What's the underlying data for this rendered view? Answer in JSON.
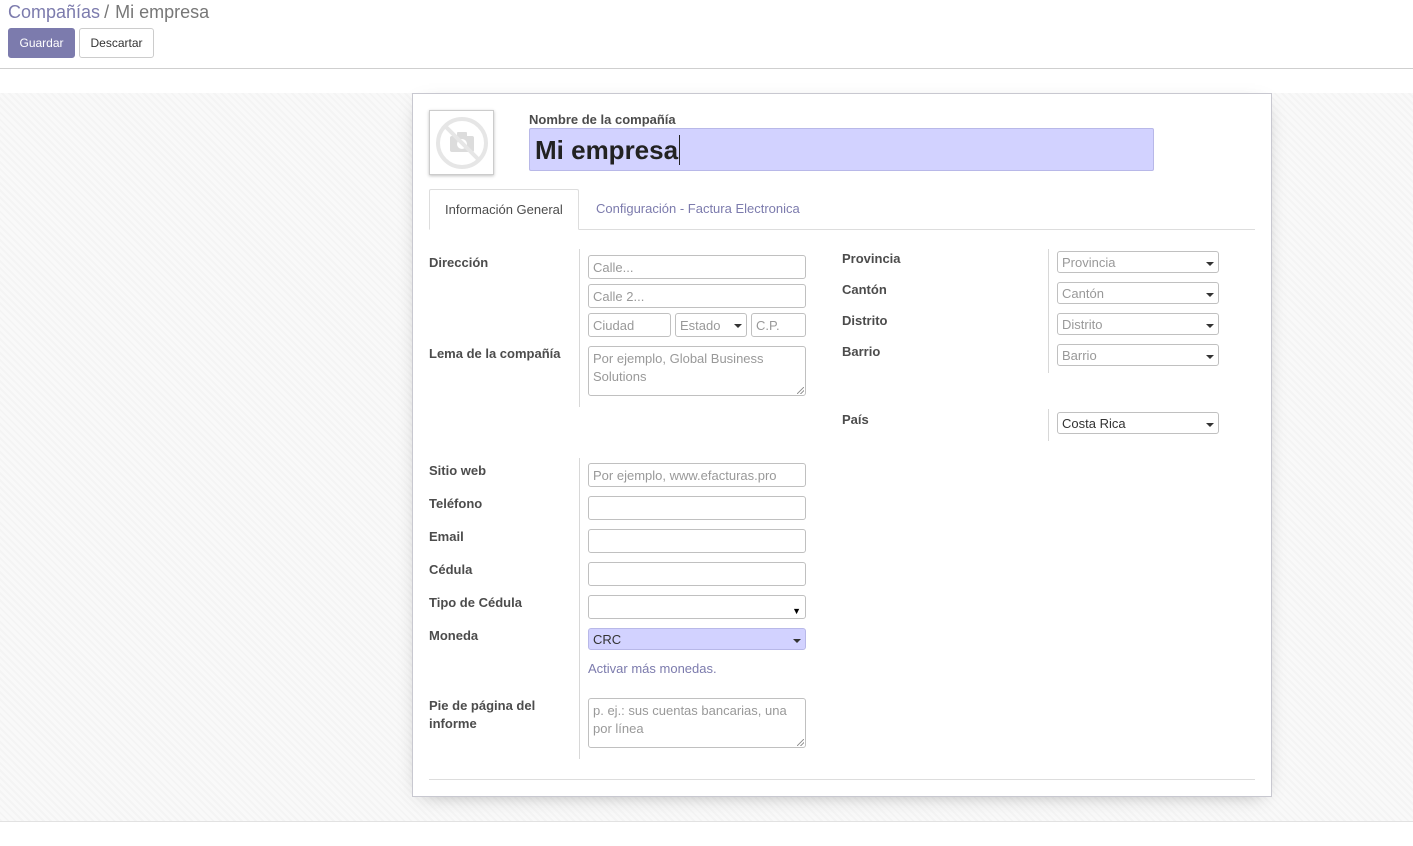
{
  "breadcrumb": {
    "parent": "Compañías",
    "separator": "/",
    "current": "Mi empresa"
  },
  "toolbar": {
    "save_label": "Guardar",
    "discard_label": "Descartar"
  },
  "form": {
    "name_label": "Nombre de la compañía",
    "name_value": "Mi empresa",
    "tabs": [
      {
        "label": "Información General",
        "active": true
      },
      {
        "label": "Configuración - Factura Electronica",
        "active": false
      }
    ],
    "address": {
      "label": "Dirección",
      "street_placeholder": "Calle...",
      "street2_placeholder": "Calle 2...",
      "city_placeholder": "Ciudad",
      "state_placeholder": "Estado",
      "zip_placeholder": "C.P."
    },
    "slogan": {
      "label": "Lema de la compañía",
      "placeholder": "Por ejemplo, Global Business Solutions"
    },
    "right": {
      "provincia": {
        "label": "Provincia",
        "placeholder": "Provincia"
      },
      "canton": {
        "label": "Cantón",
        "placeholder": " Cantón"
      },
      "distrito": {
        "label": "Distrito",
        "placeholder": "Distrito"
      },
      "barrio": {
        "label": "Barrio",
        "placeholder": "Barrio"
      },
      "pais": {
        "label": "País",
        "value": "Costa Rica"
      }
    },
    "website": {
      "label": "Sitio web",
      "placeholder": "Por ejemplo, www.efacturas.pro"
    },
    "phone": {
      "label": "Teléfono",
      "value": ""
    },
    "email": {
      "label": "Email",
      "value": ""
    },
    "cedula": {
      "label": "Cédula",
      "value": ""
    },
    "tipo_cedula": {
      "label": "Tipo de Cédula",
      "value": ""
    },
    "moneda": {
      "label": "Moneda",
      "value": "CRC",
      "link": "Activar más monedas."
    },
    "footer": {
      "label_line1": "Pie de página del",
      "label_line2": "informe",
      "placeholder": "p. ej.: sus cuentas bancarias, una por línea"
    }
  },
  "colors": {
    "accent": "#7c7bad",
    "highlight": "#d2d2ff"
  }
}
